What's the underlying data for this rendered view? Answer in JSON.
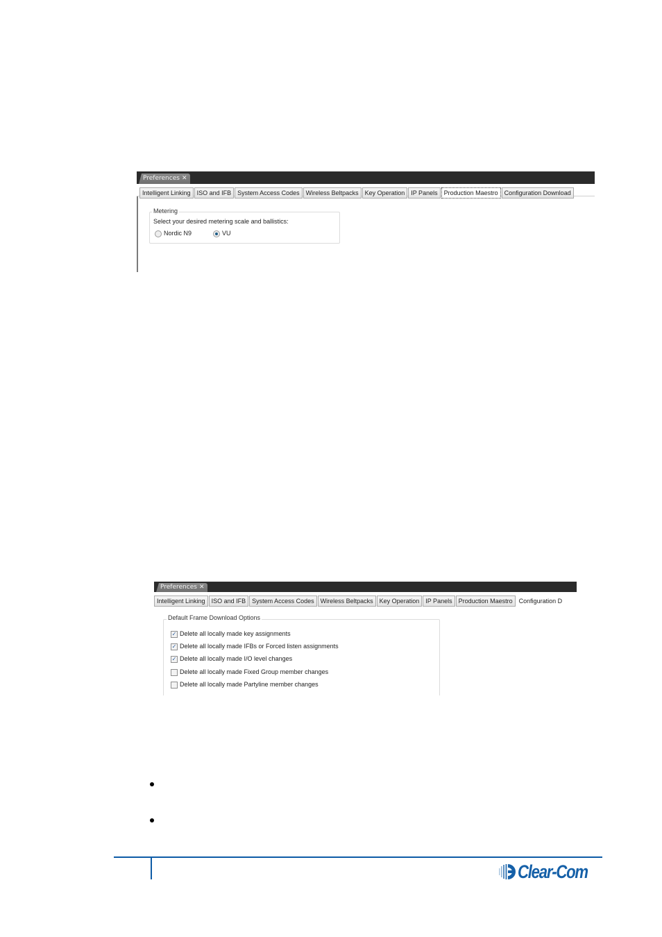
{
  "screenshot1": {
    "doc_tab": "Preferences",
    "close_glyph": "✕",
    "tabs": [
      "Intelligent Linking",
      "ISO and IFB",
      "System Access Codes",
      "Wireless Beltpacks",
      "Key Operation",
      "IP Panels",
      "Production Maestro",
      "Configuration Download"
    ],
    "active_tab": "Production Maestro",
    "group_title": "Metering",
    "prompt": "Select your desired metering scale and ballistics:",
    "options": [
      {
        "label": "Nordic N9",
        "selected": false
      },
      {
        "label": "VU",
        "selected": true
      }
    ]
  },
  "screenshot2": {
    "doc_tab": "Preferences",
    "close_glyph": "✕",
    "tabs": [
      "Intelligent Linking",
      "ISO and IFB",
      "System Access Codes",
      "Wireless Beltpacks",
      "Key Operation",
      "IP Panels",
      "Production Maestro",
      "Configuration D"
    ],
    "active_tab": "Configuration Download",
    "group_title": "Default Frame Download Options",
    "checkboxes": [
      {
        "label": "Delete all locally made key assignments",
        "checked": true
      },
      {
        "label": "Delete all locally made IFBs or Forced listen assignments",
        "checked": true
      },
      {
        "label": "Delete all locally made I/O level changes",
        "checked": true
      },
      {
        "label": "Delete all locally made Fixed Group member changes",
        "checked": false
      },
      {
        "label": "Delete all locally made Partyline member changes",
        "checked": false
      }
    ]
  },
  "bullets": [
    "",
    ""
  ],
  "footer": {
    "logo_text": "Clear-Com",
    "logo_reg": "®",
    "brand_color": "#0d5ba6"
  }
}
